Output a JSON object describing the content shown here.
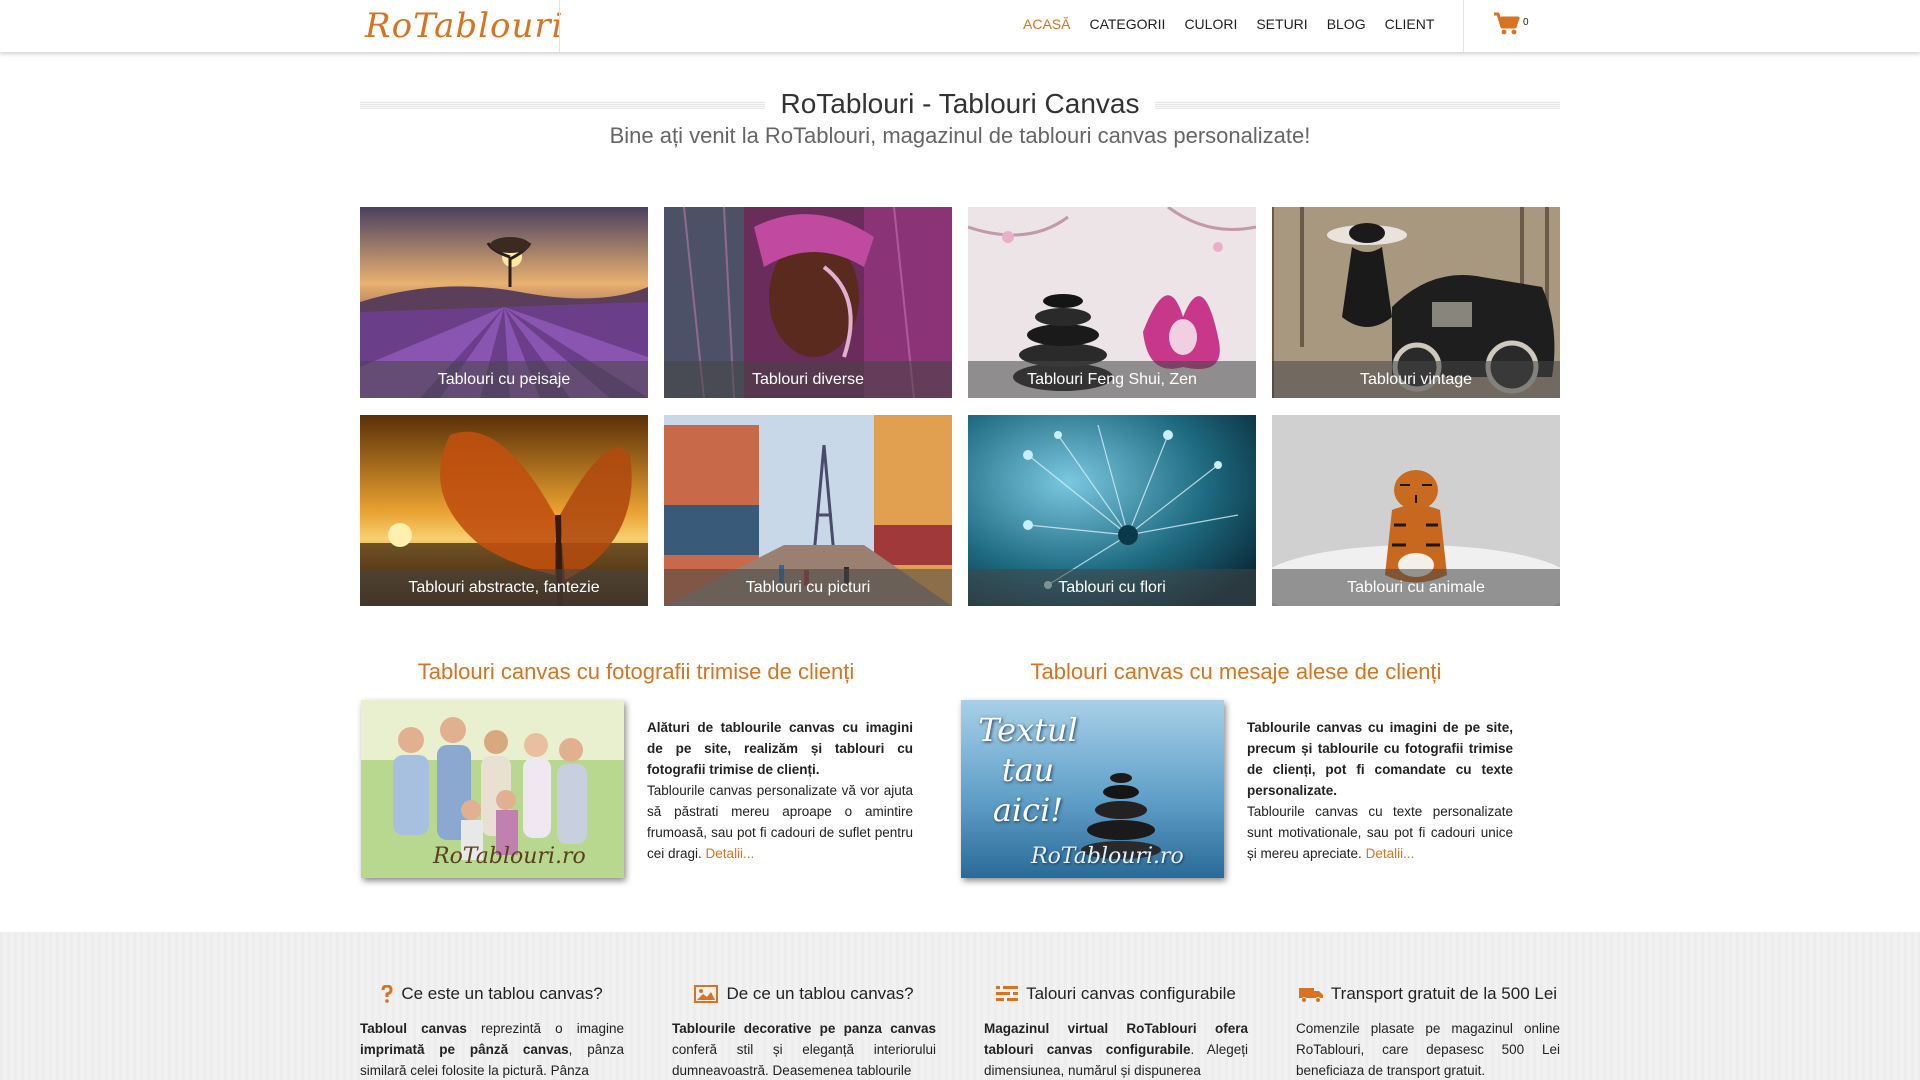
{
  "header": {
    "logo": "RoTablouri",
    "nav": [
      {
        "label": "ACASĂ",
        "active": true
      },
      {
        "label": "CATEGORII",
        "active": false
      },
      {
        "label": "CULORI",
        "active": false
      },
      {
        "label": "SETURI",
        "active": false
      },
      {
        "label": "BLOG",
        "active": false
      },
      {
        "label": "CLIENT",
        "active": false
      }
    ],
    "cart_icon": "shopping-cart-icon",
    "cart_count": "0"
  },
  "page": {
    "title": "RoTablouri - Tablouri Canvas",
    "subtitle": "Bine ați venit la RoTablouri, magazinul de tablouri canvas personalizate!"
  },
  "categories": [
    {
      "label": "Tablouri cu peisaje"
    },
    {
      "label": "Tablouri diverse"
    },
    {
      "label": "Tablouri Feng Shui, Zen"
    },
    {
      "label": "Tablouri vintage"
    },
    {
      "label": "Tablouri abstracte, fantezie"
    },
    {
      "label": "Tablouri cu picturi"
    },
    {
      "label": "Tablouri cu flori"
    },
    {
      "label": "Tablouri cu animale"
    }
  ],
  "features": [
    {
      "title": "Tablouri canvas cu fotografii trimise de clienți",
      "image_watermark": "RoTablouri.ro",
      "bold": "Alături de tablourile canvas cu imagini de pe site, realizăm și tablouri cu fotografii trimise de clienți.",
      "text": "Tablourile canvas personalizate vă vor ajuta să păstrati mereu aproape o amintire frumoasă, sau pot fi cadouri de suflet pentru cei dragi.",
      "more": "Detalii..."
    },
    {
      "title": "Tablouri canvas cu mesaje alese de clienți",
      "image_text": "Textul tau aici!",
      "image_watermark": "RoTablouri.ro",
      "bold": "Tablourile canvas cu imagini de pe site, precum și tablourile cu fotografii trimise de clienți, pot fi comandate cu texte personalizate.",
      "text": "Tablourile canvas cu texte personalizate sunt motivationale, sau pot fi cadouri unice și mereu apreciate.",
      "more": "Detalii..."
    }
  ],
  "info": [
    {
      "icon": "question-icon",
      "title": "Ce este un tablou canvas?",
      "body_parts": [
        "Tabloul canvas",
        " reprezintă o imagine ",
        "imprimată pe pânză canvas",
        ", pânza similară celei folosite la pictură. Pânza"
      ]
    },
    {
      "icon": "picture-icon",
      "title": "De ce un tablou canvas?",
      "body_parts": [
        "Tablourile decorative pe panza canvas",
        " conferă stil și eleganță interiorului dumneavoastră. Deasemenea tablourile"
      ]
    },
    {
      "icon": "configure-icon",
      "title": "Talouri canvas configurabile",
      "body_parts": [
        "Magazinul virtual RoTablouri ofera tablouri canvas configurabile",
        ". Alegeți dimensiunea, numărul și dispunerea"
      ]
    },
    {
      "icon": "truck-icon",
      "title": "Transport gratuit de la 500 Lei",
      "body_parts": [
        "Comenzile plasate pe magazinul online RoTablouri, care depasesc 500 Lei beneficiaza de transport gratuit."
      ]
    }
  ],
  "colors": {
    "accent": "#d9731f",
    "text": "#222222",
    "bottom_bg": "#f1f1f1"
  }
}
